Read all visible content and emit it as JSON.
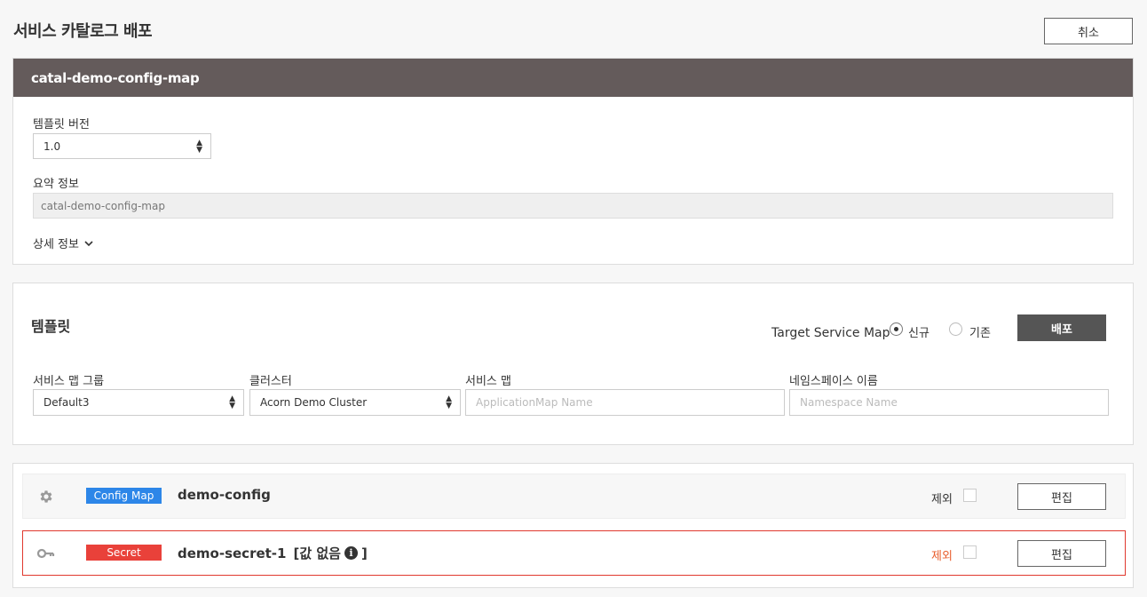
{
  "page": {
    "title": "서비스 카탈로그 배포",
    "cancel_label": "취소"
  },
  "catalog": {
    "name": "catal-demo-config-map",
    "template_version_label": "템플릿 버전",
    "template_version_value": "1.0",
    "summary_label": "요약 정보",
    "summary_value": "catal-demo-config-map",
    "detail_toggle_label": "상세 정보"
  },
  "template": {
    "title": "템플릿",
    "target_service_map_label": "Target Service Map",
    "radio_new_label": "신규",
    "radio_existing_label": "기존",
    "selected_option": "신규",
    "deploy_label": "배포",
    "fields": {
      "service_map_group_label": "서비스 맵 그룹",
      "service_map_group_value": "Default3",
      "cluster_label": "클러스터",
      "cluster_value": "Acorn Demo Cluster",
      "service_map_label": "서비스 맵",
      "service_map_placeholder": "ApplicationMap Name",
      "namespace_label": "네임스페이스 이름",
      "namespace_placeholder": "Namespace Name"
    }
  },
  "resources": [
    {
      "icon": "gear-icon",
      "type_label": "Config Map",
      "type_color": "#2d86e8",
      "name": "demo-config",
      "name_suffix": "",
      "exclude_label": "제외",
      "exclude_color": "#333333",
      "edit_label": "편집",
      "error": false
    },
    {
      "icon": "key-icon",
      "type_label": "Secret",
      "type_color": "#e9413a",
      "name": "demo-secret-1",
      "name_suffix_open": "[값 없음",
      "name_suffix_close": "]",
      "exclude_label": "제외",
      "exclude_color": "#e85c2a",
      "edit_label": "편집",
      "error": true
    }
  ],
  "colors": {
    "header_bg": "#645b5b",
    "deploy_bg": "#555555",
    "error_border": "#e0382e"
  }
}
